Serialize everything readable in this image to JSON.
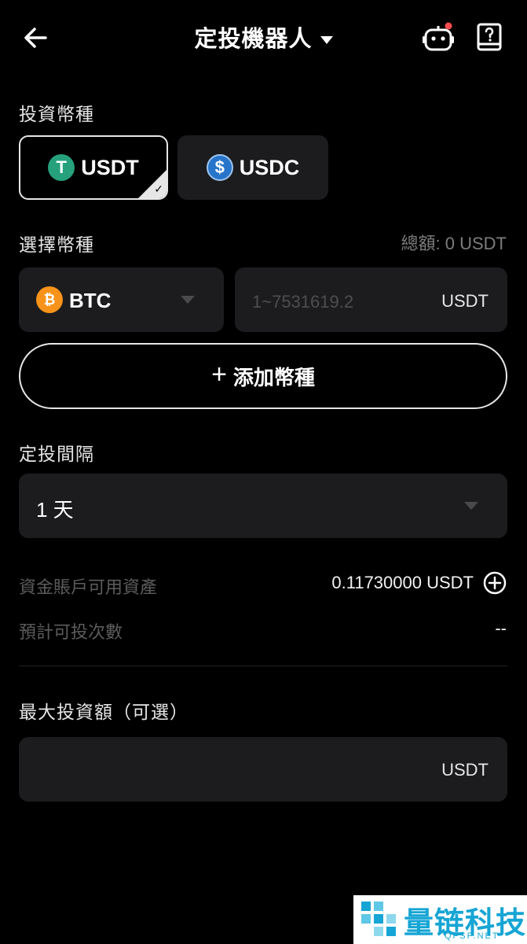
{
  "header": {
    "title": "定投機器人",
    "icons": [
      "back-arrow-icon",
      "dropdown-caret-icon",
      "robot-icon",
      "guide-book-icon"
    ],
    "robot_badge_color": "#ff4d4f"
  },
  "investment_currency": {
    "label": "投資幣種",
    "options": [
      {
        "name": "USDT",
        "icon_letter": "T",
        "icon_color": "#26a17b",
        "selected": true
      },
      {
        "name": "USDC",
        "icon_letter": "$",
        "icon_color": "#2775ca",
        "selected": false
      }
    ]
  },
  "select_currency": {
    "label": "選擇幣種",
    "total": "總額: 0 USDT",
    "coin": {
      "name": "BTC",
      "icon_letter": "₿",
      "icon_color": "#f7931a"
    },
    "amount_placeholder": "1~7531619.2",
    "amount_unit": "USDT",
    "add_label": "添加幣種"
  },
  "interval": {
    "label": "定投間隔",
    "value": "1 天"
  },
  "info": {
    "available_label": "資金賬戶可用資產",
    "available_value": "0.11730000 USDT",
    "estimated_label": "預計可投次數",
    "estimated_value": "--"
  },
  "max_investment": {
    "label": "最大投資額（可選）",
    "unit": "USDT"
  },
  "watermark": {
    "text": "量链科技",
    "sub": "QFSP.NET"
  }
}
